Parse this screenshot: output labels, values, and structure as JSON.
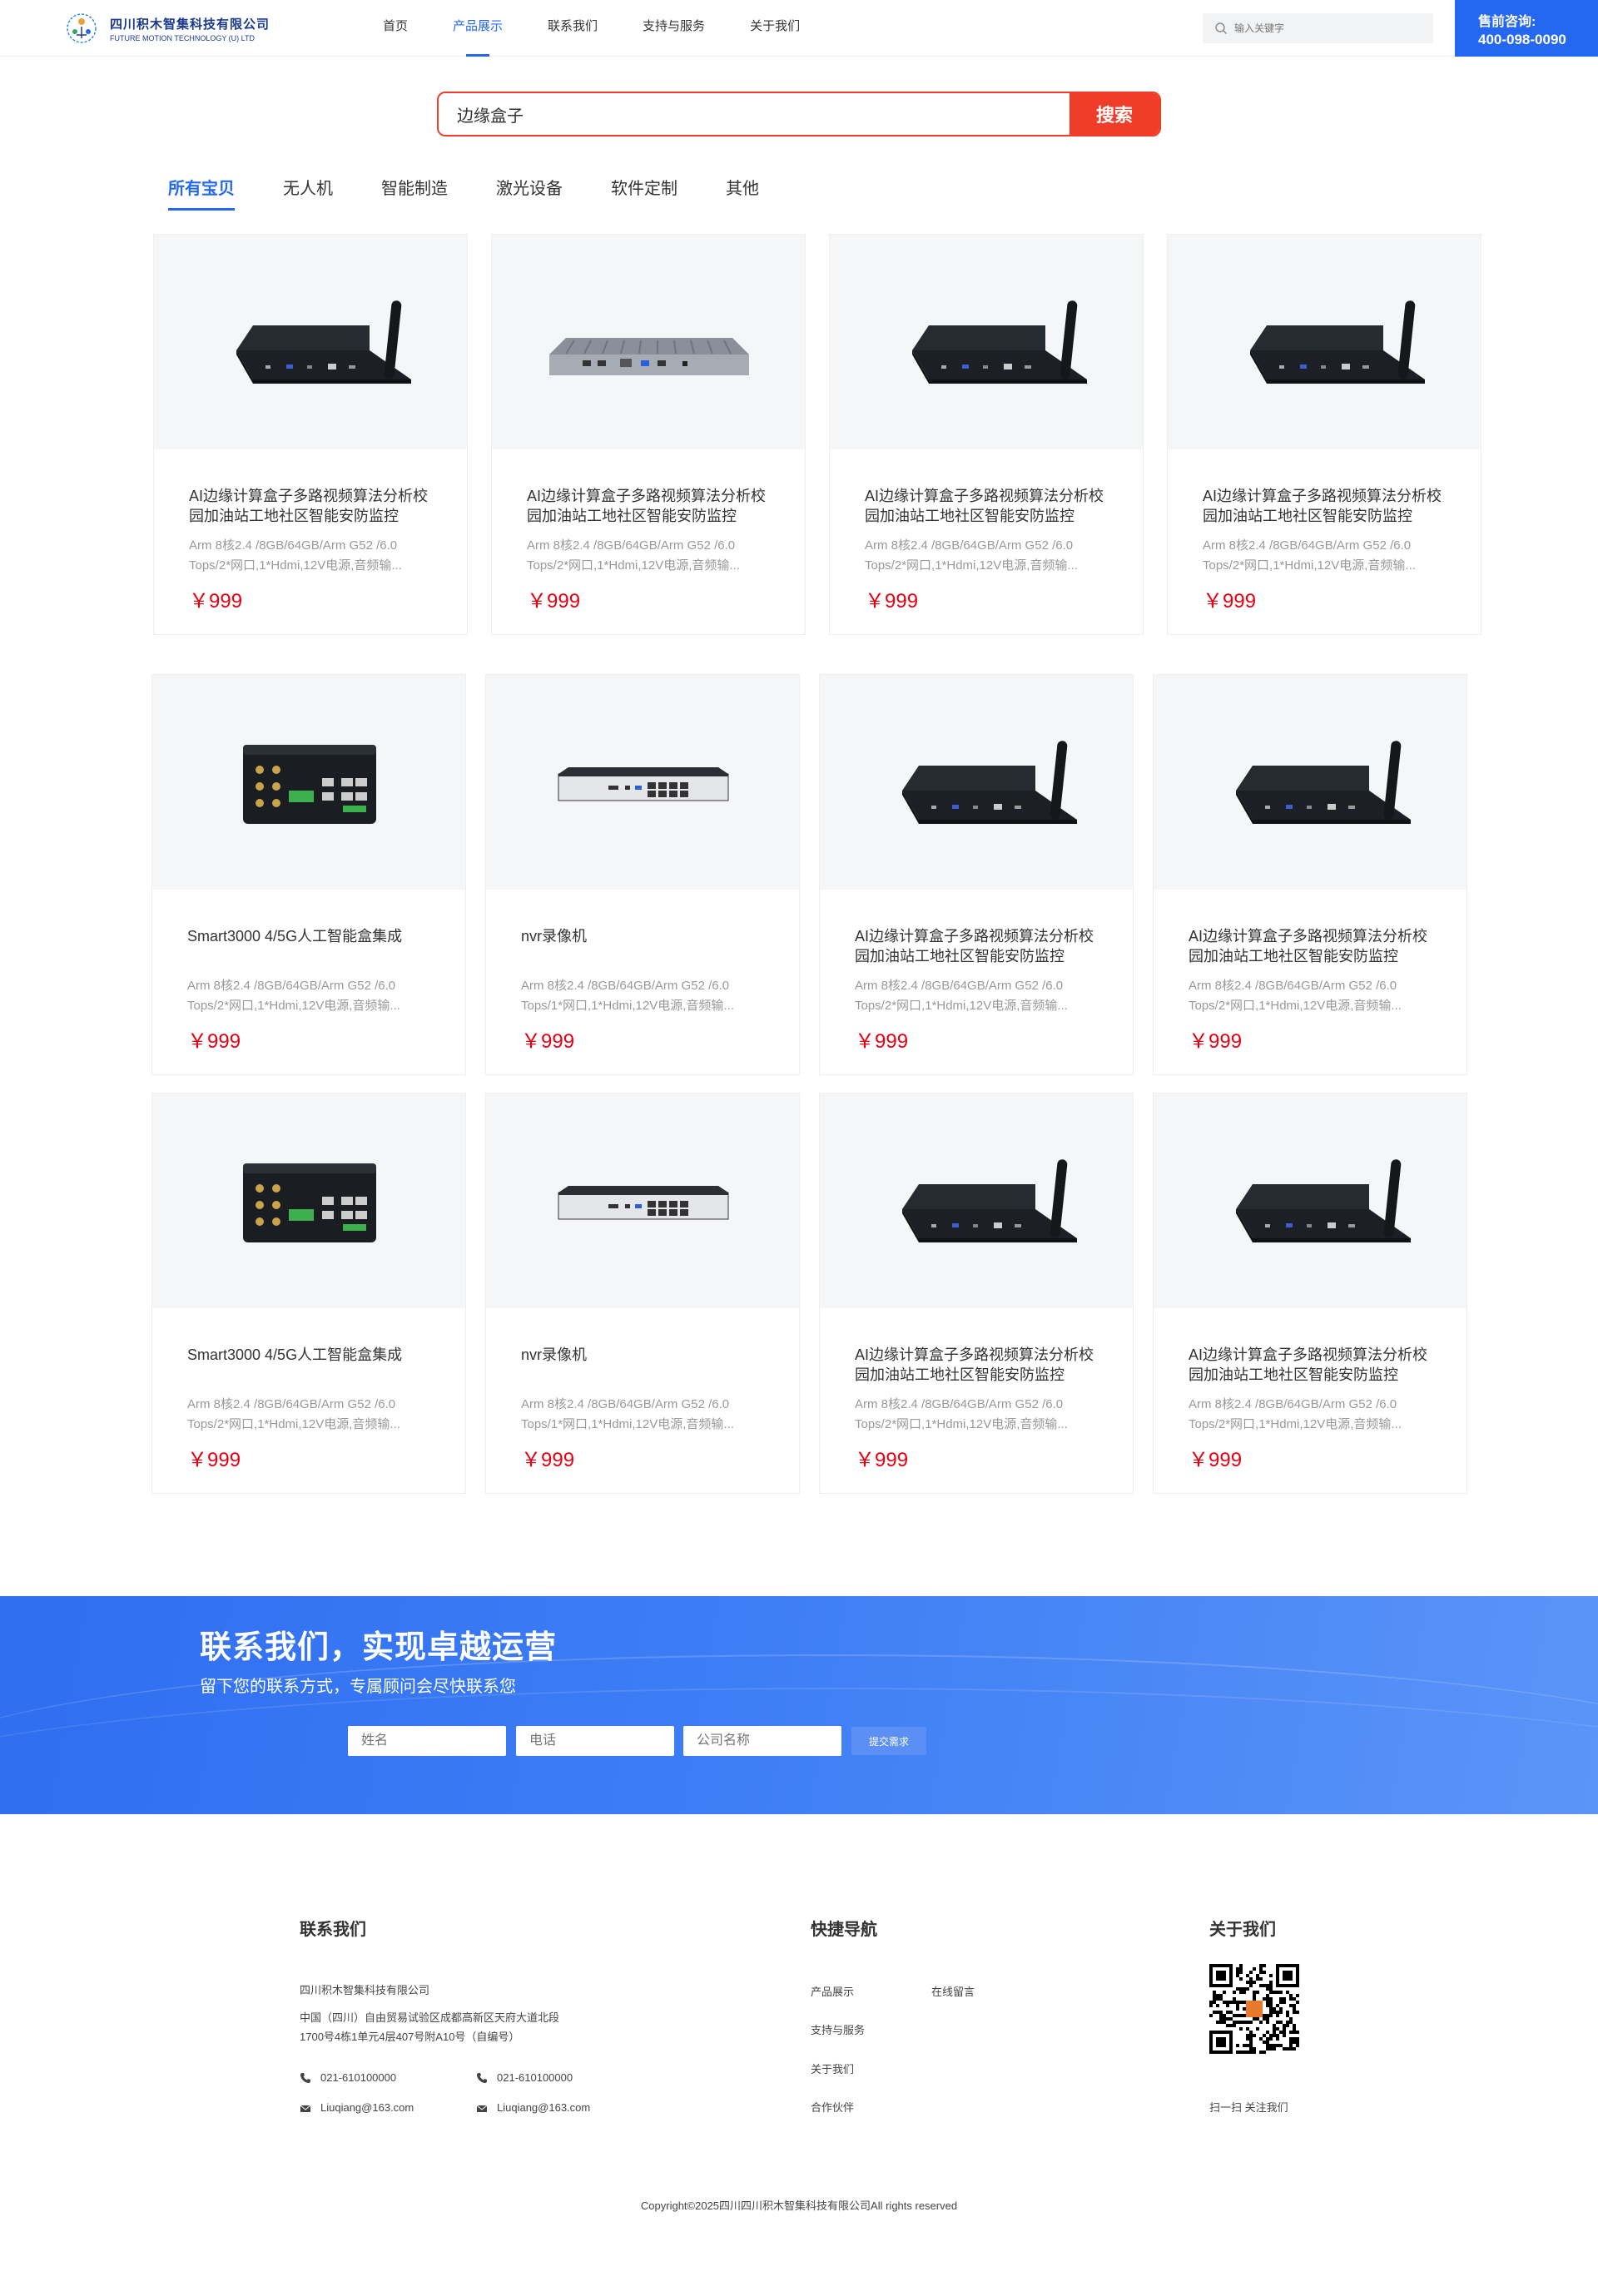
{
  "header": {
    "logo_cn": "四川积木智集科技有限公司",
    "logo_en": "FUTURE MOTION TECHNOLOGY (U) LTD",
    "nav": [
      "首页",
      "产品展示",
      "联系我们",
      "支持与服务",
      "关于我们"
    ],
    "search_placeholder": "输入关键字",
    "hotline_label": "售前咨询:",
    "hotline_number": "400-098-0090"
  },
  "search": {
    "value": "边缘盒子",
    "button": "搜索"
  },
  "tabs": [
    "所有宝贝",
    "无人机",
    "智能制造",
    "激光设备",
    "软件定制",
    "其他"
  ],
  "products": [
    {
      "type": "router",
      "title": "AI边缘计算盒子多路视频算法分析校园加油站工地社区智能安防监控",
      "desc": "Arm 8核2.4 /8GB/64GB/Arm G52 /6.0 Tops/2*网口,1*Hdmi,12V电源,音频输...",
      "price": "￥999"
    },
    {
      "type": "silver",
      "title": "AI边缘计算盒子多路视频算法分析校园加油站工地社区智能安防监控",
      "desc": "Arm 8核2.4 /8GB/64GB/Arm G52 /6.0 Tops/2*网口,1*Hdmi,12V电源,音频输...",
      "price": "￥999"
    },
    {
      "type": "router",
      "title": "AI边缘计算盒子多路视频算法分析校园加油站工地社区智能安防监控",
      "desc": "Arm 8核2.4 /8GB/64GB/Arm G52 /6.0 Tops/2*网口,1*Hdmi,12V电源,音频输...",
      "price": "￥999"
    },
    {
      "type": "router",
      "title": "AI边缘计算盒子多路视频算法分析校园加油站工地社区智能安防监控",
      "desc": "Arm 8核2.4 /8GB/64GB/Arm G52 /6.0 Tops/2*网口,1*Hdmi,12V电源,音频输...",
      "price": "￥999"
    },
    {
      "type": "smart",
      "title": "Smart3000 4/5G人工智能盒集成",
      "desc": "Arm 8核2.4 /8GB/64GB/Arm G52 /6.0 Tops/2*网口,1*Hdmi,12V电源,音频输...",
      "price": "￥999"
    },
    {
      "type": "nvr",
      "title": "nvr录像机",
      "desc": "Arm 8核2.4 /8GB/64GB/Arm G52 /6.0 Tops/1*网口,1*Hdmi,12V电源,音频输...",
      "price": "￥999"
    },
    {
      "type": "router",
      "title": "AI边缘计算盒子多路视频算法分析校园加油站工地社区智能安防监控",
      "desc": "Arm 8核2.4 /8GB/64GB/Arm G52 /6.0 Tops/2*网口,1*Hdmi,12V电源,音频输...",
      "price": "￥999"
    },
    {
      "type": "router",
      "title": "AI边缘计算盒子多路视频算法分析校园加油站工地社区智能安防监控",
      "desc": "Arm 8核2.4 /8GB/64GB/Arm G52 /6.0 Tops/2*网口,1*Hdmi,12V电源,音频输...",
      "price": "￥999"
    },
    {
      "type": "smart",
      "title": "Smart3000 4/5G人工智能盒集成",
      "desc": "Arm 8核2.4 /8GB/64GB/Arm G52 /6.0 Tops/2*网口,1*Hdmi,12V电源,音频输...",
      "price": "￥999"
    },
    {
      "type": "nvr",
      "title": "nvr录像机",
      "desc": "Arm 8核2.4 /8GB/64GB/Arm G52 /6.0 Tops/1*网口,1*Hdmi,12V电源,音频输...",
      "price": "￥999"
    },
    {
      "type": "router",
      "title": "AI边缘计算盒子多路视频算法分析校园加油站工地社区智能安防监控",
      "desc": "Arm 8核2.4 /8GB/64GB/Arm G52 /6.0 Tops/2*网口,1*Hdmi,12V电源,音频输...",
      "price": "￥999"
    },
    {
      "type": "router",
      "title": "AI边缘计算盒子多路视频算法分析校园加油站工地社区智能安防监控",
      "desc": "Arm 8核2.4 /8GB/64GB/Arm G52 /6.0 Tops/2*网口,1*Hdmi,12V电源,音频输...",
      "price": "￥999"
    }
  ],
  "banner": {
    "title": "联系我们，实现卓越运营",
    "subtitle": "留下您的联系方式，专属顾问会尽快联系您",
    "name_placeholder": "姓名",
    "phone_placeholder": "电话",
    "company_placeholder": "公司名称",
    "submit": "提交需求"
  },
  "footer": {
    "contact_heading": "联系我们",
    "company": "四川积木智集科技有限公司",
    "address_1": "中国（四川）自由贸易试验区成都高新区天府大道北段",
    "address_2": "1700号4栋1单元4层407号附A10号（自编号）",
    "phone_1": "021-610100000",
    "phone_2": "021-610100000",
    "email_1": "Liuqiang@163.com",
    "email_2": "Liuqiang@163.com",
    "nav_heading": "快捷导航",
    "nav_links": [
      "产品展示",
      "支持与服务",
      "关于我们",
      "合作伙伴"
    ],
    "nav_link_online": "在线留言",
    "about_heading": "关于我们",
    "qr_caption": "扫一扫 关注我们",
    "copyright": "Copyright©2025四川四川积木智集科技有限公司All rights reserved"
  }
}
